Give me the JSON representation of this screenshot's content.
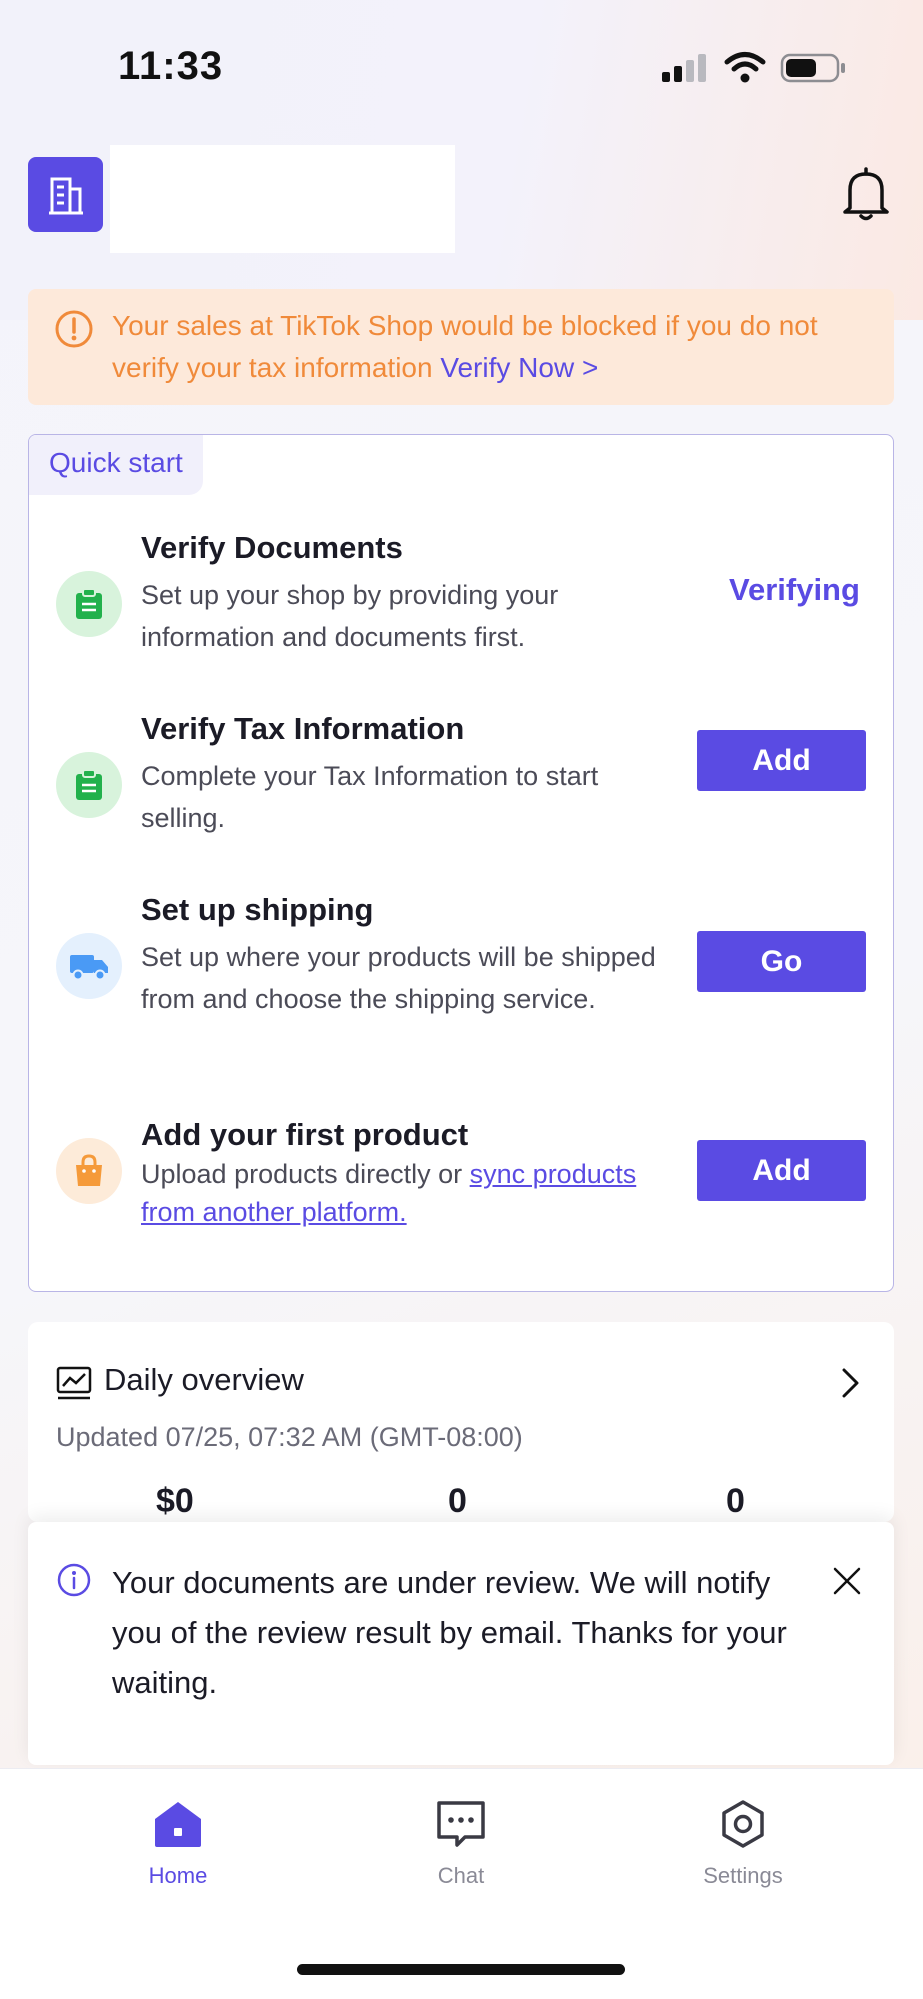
{
  "status_bar": {
    "time": "11:33"
  },
  "header": {
    "notifications_icon": "bell-icon",
    "shop_icon": "building-icon"
  },
  "tax_banner": {
    "message": "Your sales at TikTok Shop would be blocked if you do not verify your tax information ",
    "link": "Verify Now >",
    "colors": {
      "background": "#fde9da",
      "text": "#f08a3a",
      "link": "#5a4be3"
    }
  },
  "quick_start": {
    "tag": "Quick start",
    "tasks": [
      {
        "title": "Verify Documents",
        "description": "Set up your shop by providing your information and documents first.",
        "status": "Verifying",
        "icon": "clipboard-icon"
      },
      {
        "title": "Verify Tax Information",
        "description": "Complete your Tax Information to start selling.",
        "button": "Add",
        "icon": "clipboard-icon"
      },
      {
        "title": "Set up shipping",
        "description": "Set up where your products will be shipped from and choose the shipping service.",
        "button": "Go",
        "icon": "truck-icon"
      },
      {
        "title": "Add your first product",
        "description_prefix": "Upload products directly or ",
        "description_link": "sync products from another platform.",
        "button": "Add",
        "icon": "shopping-bag-icon"
      }
    ]
  },
  "daily_overview": {
    "title": "Daily overview",
    "updated": "Updated 07/25, 07:32 AM (GMT-08:00)",
    "metrics": [
      "$0",
      "0",
      "0"
    ]
  },
  "toast": {
    "message": "Your documents are under review. We will notify you of the review result by email. Thanks for your waiting."
  },
  "bottom_nav": {
    "items": [
      {
        "label": "Home",
        "icon": "home-icon",
        "active": true
      },
      {
        "label": "Chat",
        "icon": "chat-icon",
        "active": false
      },
      {
        "label": "Settings",
        "icon": "settings-icon",
        "active": false
      }
    ]
  },
  "colors": {
    "accent": "#5a4be3"
  }
}
